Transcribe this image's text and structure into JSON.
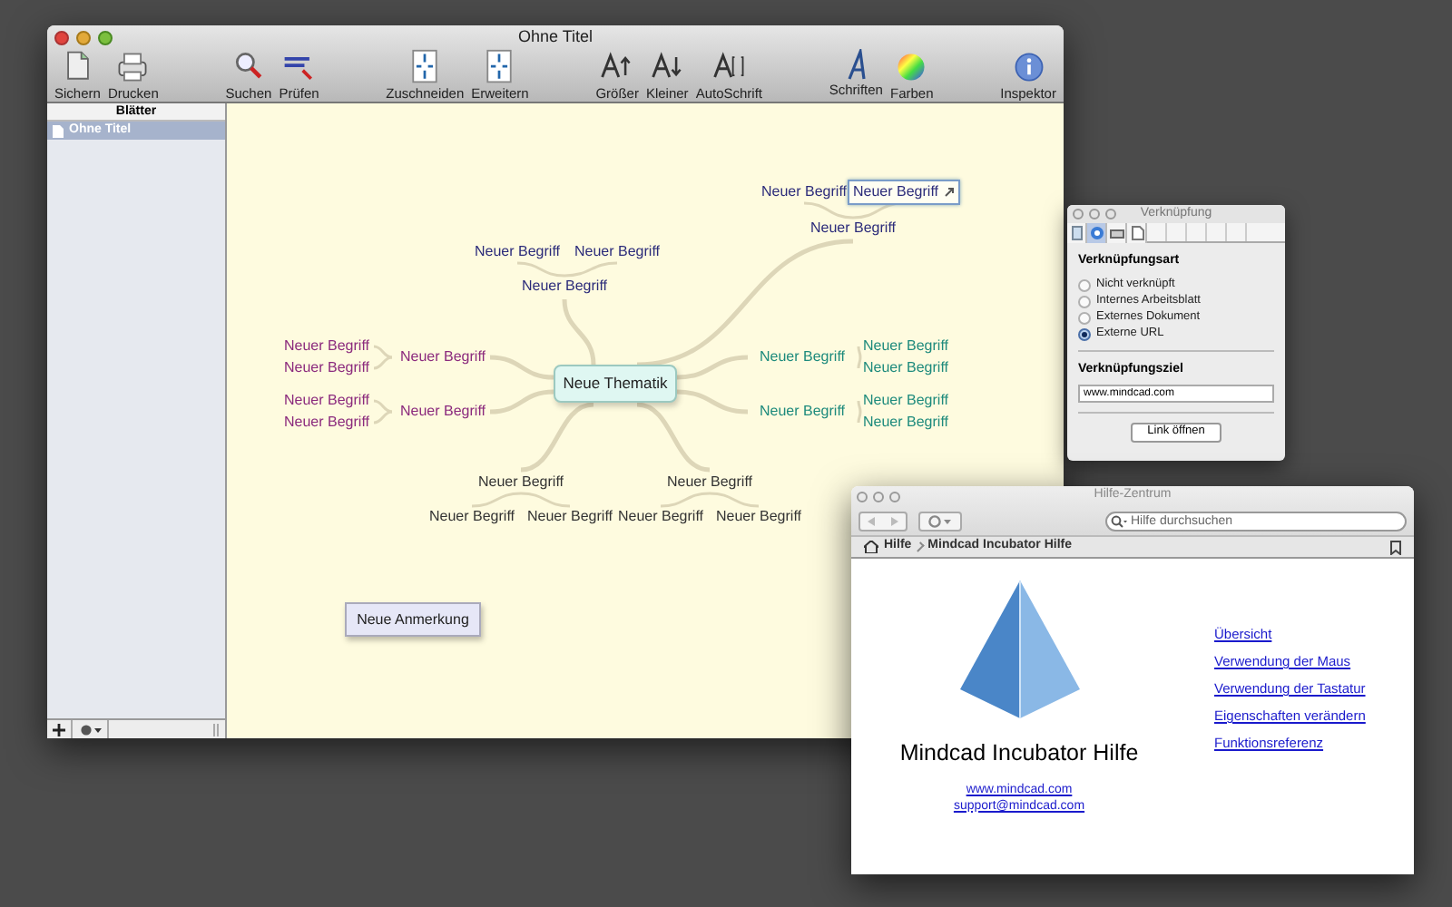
{
  "main_window": {
    "title": "Ohne Titel",
    "toolbar": [
      {
        "label": "Sichern",
        "kind": "save"
      },
      {
        "label": "Drucken",
        "kind": "print"
      },
      {
        "label": "Suchen",
        "kind": "search"
      },
      {
        "label": "Prüfen",
        "kind": "spell"
      },
      {
        "label": "Zuschneiden",
        "kind": "shrink"
      },
      {
        "label": "Erweitern",
        "kind": "expand"
      },
      {
        "label": "Größer",
        "kind": "bigger"
      },
      {
        "label": "Kleiner",
        "kind": "smaller"
      },
      {
        "label": "AutoSchrift",
        "kind": "autofont"
      },
      {
        "label": "Schriften",
        "kind": "fonts"
      },
      {
        "label": "Farben",
        "kind": "colors"
      },
      {
        "label": "Inspektor",
        "kind": "inspector"
      }
    ],
    "sidebar": {
      "header": "Blätter",
      "items": [
        {
          "label": "Ohne Titel",
          "selected": true
        }
      ]
    },
    "map": {
      "central": "Neue Thematik",
      "note": "Neue Anmerkung",
      "branches": [
        {
          "label": "Neuer Begriff",
          "color": "#2b2b7a",
          "selected": false,
          "children": [
            {
              "label": "Neuer Begriff",
              "selected": false,
              "linked": false
            },
            {
              "label": "Neuer Begriff",
              "selected": true,
              "linked": true
            }
          ]
        },
        {
          "label": "Neuer Begriff",
          "color": "#2b2b7a",
          "selected": false,
          "children": [
            {
              "label": "Neuer Begriff",
              "selected": false,
              "linked": false
            },
            {
              "label": "Neuer Begriff",
              "selected": false,
              "linked": false
            }
          ]
        },
        {
          "label": "Neuer Begriff",
          "color": "#8b2a7d",
          "selected": false,
          "children": [
            {
              "label": "Neuer Begriff",
              "selected": false,
              "linked": false
            },
            {
              "label": "Neuer Begriff",
              "selected": false,
              "linked": false
            }
          ]
        },
        {
          "label": "Neuer Begriff",
          "color": "#8b2a7d",
          "selected": false,
          "children": [
            {
              "label": "Neuer Begriff",
              "selected": false,
              "linked": false
            },
            {
              "label": "Neuer Begriff",
              "selected": false,
              "linked": false
            }
          ]
        },
        {
          "label": "Neuer Begriff",
          "color": "#1d8a7c",
          "selected": false,
          "children": [
            {
              "label": "Neuer Begriff",
              "selected": false,
              "linked": false
            },
            {
              "label": "Neuer Begriff",
              "selected": false,
              "linked": false
            }
          ]
        },
        {
          "label": "Neuer Begriff",
          "color": "#1d8a7c",
          "selected": false,
          "children": [
            {
              "label": "Neuer Begriff",
              "selected": false,
              "linked": false
            },
            {
              "label": "Neuer Begriff",
              "selected": false,
              "linked": false
            }
          ]
        },
        {
          "label": "Neuer Begriff",
          "color": "#333333",
          "selected": false,
          "children": [
            {
              "label": "Neuer Begriff",
              "selected": false,
              "linked": false
            },
            {
              "label": "Neuer Begriff",
              "selected": false,
              "linked": false
            }
          ]
        },
        {
          "label": "Neuer Begriff",
          "color": "#333333",
          "selected": false,
          "children": [
            {
              "label": "Neuer Begriff",
              "selected": false,
              "linked": false
            },
            {
              "label": "Neuer Begriff",
              "selected": false,
              "linked": false
            }
          ]
        }
      ]
    }
  },
  "inspector": {
    "title": "Verknüpfung",
    "tabs": [
      {
        "kind": "sheet",
        "selected": false
      },
      {
        "kind": "link",
        "selected": true
      },
      {
        "kind": "print",
        "selected": false
      },
      {
        "kind": "page",
        "selected": false
      }
    ],
    "section_1": "Verknüpfungsart",
    "options": [
      {
        "label": "Nicht verknüpft",
        "selected": false
      },
      {
        "label": "Internes Arbeitsblatt",
        "selected": false
      },
      {
        "label": "Externes Dokument",
        "selected": false
      },
      {
        "label": "Externe URL",
        "selected": true
      }
    ],
    "section_2": "Verknüpfungsziel",
    "target": "www.mindcad.com",
    "button": "Link öffnen"
  },
  "help_window": {
    "title": "Hilfe-Zentrum",
    "search": {
      "placeholder": "Hilfe durchsuchen"
    },
    "breadcrumb": [
      "Hilfe",
      "Mindcad Incubator Hilfe"
    ],
    "heading": "Mindcad Incubator Hilfe",
    "contact_links": [
      "www.mindcad.com",
      "support@mindcad.com"
    ],
    "topics": [
      "Übersicht",
      "Verwendung der Maus",
      "Verwendung der Tastatur",
      "Eigenschaften verändern",
      "Funktionsreferenz"
    ]
  }
}
